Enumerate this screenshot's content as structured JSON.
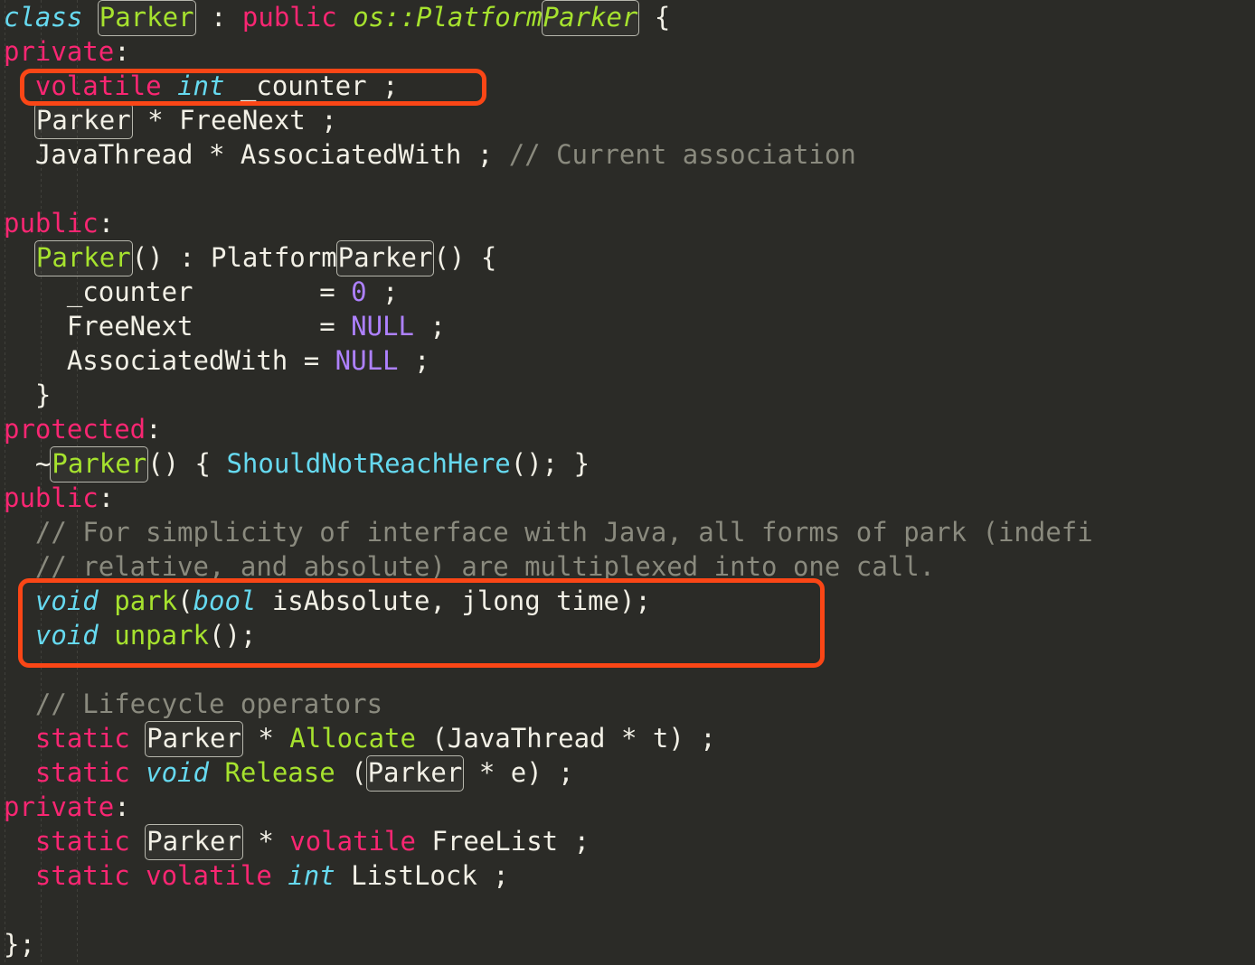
{
  "editor": {
    "background": "#2b2b27",
    "language": "C++",
    "annotation_color": "#fa4616",
    "occurrence_box_color": "#b7b7ad"
  },
  "palette": {
    "keyword": "#f92672",
    "type": "#66d9ef",
    "class_name": "#a6e22e",
    "function": "#a6e22e",
    "constant": "#ae81ff",
    "plain": "#f2f0e6",
    "comment": "#8a8a7e"
  },
  "code": {
    "line01": {
      "c1": "class ",
      "c2": "Parker",
      "c3": " : ",
      "c4": "public ",
      "c5": "os::Platform",
      "c6": "Parker",
      "c7": " {"
    },
    "line02": {
      "c1": "private",
      "c2": ":"
    },
    "line03": {
      "c1": "  ",
      "c2": "volatile ",
      "c3": "int",
      "c4": " _counter ;"
    },
    "line04": {
      "c1": "  ",
      "c2": "Parker",
      "c3": " * FreeNext ;"
    },
    "line05": {
      "c1": "  JavaThread * AssociatedWith ; ",
      "c2": "// Current association"
    },
    "line06": {
      "c1": ""
    },
    "line07": {
      "c1": "public",
      "c2": ":"
    },
    "line08": {
      "c1": "  ",
      "c2": "Parker",
      "c3": "() : Platform",
      "c4": "Parker",
      "c5": "() {"
    },
    "line09": {
      "c1": "    _counter        = ",
      "c2": "0",
      "c3": " ;"
    },
    "line10": {
      "c1": "    FreeNext        = ",
      "c2": "NULL",
      "c3": " ;"
    },
    "line11": {
      "c1": "    AssociatedWith = ",
      "c2": "NULL",
      "c3": " ;"
    },
    "line12": {
      "c1": "  }"
    },
    "line13": {
      "c1": "protected",
      "c2": ":"
    },
    "line14": {
      "c1": "  ~",
      "c2": "Parker",
      "c3": "() { ",
      "c4": "ShouldNotReachHere",
      "c5": "(); }"
    },
    "line15": {
      "c1": "public",
      "c2": ":"
    },
    "line16": {
      "c1": "  // For simplicity of interface with Java, all forms of park (indefi"
    },
    "line17": {
      "c1": "  // relative, and absolute) are multiplexed into one call."
    },
    "line18": {
      "c1": "  ",
      "c2": "void",
      "c3": " ",
      "c4": "park",
      "c5": "(",
      "c6": "bool",
      "c7": " isAbsolute, jlong time);"
    },
    "line19": {
      "c1": "  ",
      "c2": "void",
      "c3": " ",
      "c4": "unpark",
      "c5": "();"
    },
    "line20": {
      "c1": ""
    },
    "line21": {
      "c1": "  ",
      "c2": "// Lifecycle operators"
    },
    "line22": {
      "c1": "  ",
      "c2": "static ",
      "c3": "Parker",
      "c4": " * ",
      "c5": "Allocate",
      "c6": " (JavaThread * t) ;"
    },
    "line23": {
      "c1": "  ",
      "c2": "static ",
      "c3": "void",
      "c4": " ",
      "c5": "Release",
      "c6": " (",
      "c7": "Parker",
      "c8": " * e) ;"
    },
    "line24": {
      "c1": "private",
      "c2": ":"
    },
    "line25": {
      "c1": "  ",
      "c2": "static ",
      "c3": "Parker",
      "c4": " * ",
      "c5": "volatile",
      "c6": " FreeList ;"
    },
    "line26": {
      "c1": "  ",
      "c2": "static ",
      "c3": "volatile ",
      "c4": "int",
      "c5": " ListLock ;"
    },
    "line27": {
      "c1": ""
    },
    "line28": {
      "c1": "};"
    }
  },
  "annotations": [
    {
      "id": "counter-highlight",
      "target": "volatile int _counter ;",
      "color": "#fa4616"
    },
    {
      "id": "park-unpark-highlight",
      "target": "void park(bool isAbsolute, jlong time); / void unpark();",
      "color": "#fa4616"
    }
  ]
}
